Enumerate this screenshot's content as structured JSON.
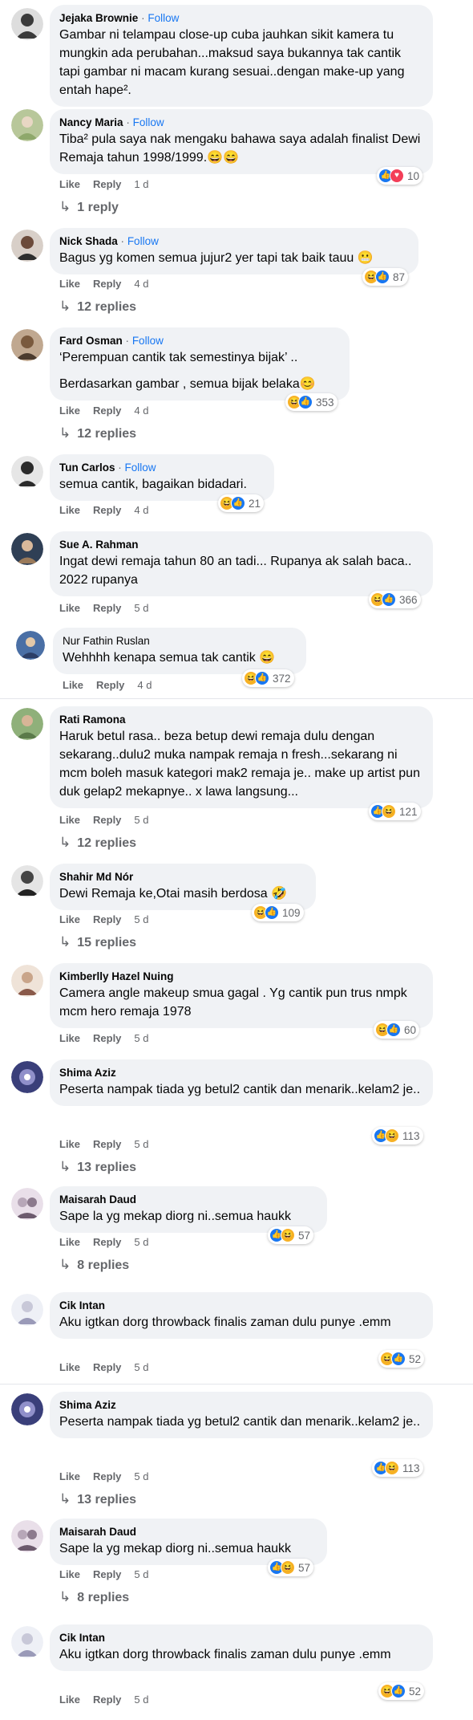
{
  "comments": [
    {
      "name": "Jejaka Brownie",
      "follow": "Follow",
      "lines": [
        "Gambar ni telampau close-up cuba jauhkan sikit kamera tu mungkin ada perubahan...maksud saya bukannya tak cantik tapi gambar ni macam kurang sesuai..dengan make-up yang entah hape²."
      ],
      "avatar_color": "#3a3a3a"
    },
    {
      "name": "Nancy Maria",
      "follow": "Follow",
      "lines": [
        "Tiba² pula saya nak mengaku bahawa saya adalah finalist Dewi Remaja tahun 1998/1999.😄😄"
      ],
      "like": "Like",
      "reply": "Reply",
      "time": "1 d",
      "reaction_count": "10",
      "reactions": [
        "like",
        "love"
      ],
      "replies": "1 reply",
      "avatar_color": "#b8c79a"
    },
    {
      "name": "Nick Shada",
      "follow": "Follow",
      "lines": [
        "Bagus yg komen semua jujur2 yer tapi tak baik tauu 😬"
      ],
      "like": "Like",
      "reply": "Reply",
      "time": "4 d",
      "reaction_count": "87",
      "reactions": [
        "haha",
        "like"
      ],
      "replies": "12 replies",
      "avatar_color": "#6b4a3a"
    },
    {
      "name": "Fard Osman",
      "follow": "Follow",
      "lines": [
        "‘Perempuan cantik tak semestinya bijak’ ..",
        "Berdasarkan gambar , semua bijak belaka😊"
      ],
      "like": "Like",
      "reply": "Reply",
      "time": "4 d",
      "reaction_count": "353",
      "reactions": [
        "haha",
        "like"
      ],
      "replies": "12 replies",
      "avatar_color": "#7a5a3e"
    },
    {
      "name": "Tun Carlos",
      "follow": "Follow",
      "lines": [
        "semua cantik, bagaikan bidadari."
      ],
      "like": "Like",
      "reply": "Reply",
      "time": "4 d",
      "reaction_count": "21",
      "reactions": [
        "haha",
        "like"
      ],
      "avatar_color": "#2b2b2b"
    },
    {
      "name": "Sue A. Rahman",
      "lines": [
        "Ingat dewi remaja tahun 80 an tadi... Rupanya ak salah baca.. 2022 rupanya"
      ],
      "like": "Like",
      "reply": "Reply",
      "time": "5 d",
      "reaction_count": "366",
      "reactions": [
        "haha",
        "like"
      ],
      "avatar_color": "#2f3f55"
    },
    {
      "name": "Nur Fathin Ruslan",
      "lines": [
        "Wehhhh kenapa semua tak cantik 😄"
      ],
      "like": "Like",
      "reply": "Reply",
      "time": "4 d",
      "reaction_count": "372",
      "reactions": [
        "haha",
        "like"
      ],
      "avatar_color": "#4a6fa5"
    },
    {
      "name": "Rati Ramona",
      "lines": [
        "Haruk betul rasa.. beza betup dewi remaja dulu dengan sekarang..dulu2 muka nampak remaja n fresh...sekarang ni mcm boleh masuk kategori mak2 remaja je.. make up artist pun duk gelap2 mekapnye.. x lawa langsung..."
      ],
      "like": "Like",
      "reply": "Reply",
      "time": "5 d",
      "reaction_count": "121",
      "reactions": [
        "like",
        "haha"
      ],
      "replies": "12 replies",
      "avatar_color": "#5a7a4a"
    },
    {
      "name": "Shahir Md Nór",
      "lines": [
        "Dewi Remaja ke,Otai masih berdosa 🤣"
      ],
      "like": "Like",
      "reply": "Reply",
      "time": "5 d",
      "reaction_count": "109",
      "reactions": [
        "haha",
        "like"
      ],
      "replies": "15 replies",
      "avatar_color": "#444444"
    },
    {
      "name": "Kimberlly Hazel Nuing",
      "lines": [
        "Camera angle makeup smua gagal . Yg cantik pun trus nmpk mcm hero remaja 1978"
      ],
      "like": "Like",
      "reply": "Reply",
      "time": "5 d",
      "reaction_count": "60",
      "reactions": [
        "haha",
        "like"
      ],
      "avatar_color": "#c9a58a"
    },
    {
      "name": "Shima Aziz",
      "lines": [
        "Peserta nampak tiada yg betul2 cantik dan menarik..kelam2 je.."
      ],
      "like": "Like",
      "reply": "Reply",
      "time": "5 d",
      "reaction_count": "113",
      "reactions": [
        "like",
        "haha"
      ],
      "replies": "13 replies",
      "avatar_color": "#3a3f7a"
    },
    {
      "name": "Maisarah Daud",
      "lines": [
        "Sape la yg mekap diorg ni..semua haukk"
      ],
      "like": "Like",
      "reply": "Reply",
      "time": "5 d",
      "reaction_count": "57",
      "reactions": [
        "like",
        "haha"
      ],
      "replies": "8 replies",
      "avatar_color": "#b7a7b8"
    },
    {
      "name": "Cik Intan",
      "lines": [
        "Aku igtkan dorg throwback finalis zaman dulu punye .emm"
      ],
      "like": "Like",
      "reply": "Reply",
      "time": "5 d",
      "reaction_count": "52",
      "reactions": [
        "haha",
        "like"
      ],
      "avatar_color": "#c8c8d8"
    },
    {
      "name": "Shima Aziz",
      "lines": [
        "Peserta nampak tiada yg betul2 cantik dan menarik..kelam2 je.."
      ],
      "like": "Like",
      "reply": "Reply",
      "time": "5 d",
      "reaction_count": "113",
      "reactions": [
        "like",
        "haha"
      ],
      "replies": "13 replies",
      "avatar_color": "#3a3f7a"
    },
    {
      "name": "Maisarah Daud",
      "lines": [
        "Sape la yg mekap diorg ni..semua haukk"
      ],
      "like": "Like",
      "reply": "Reply",
      "time": "5 d",
      "reaction_count": "57",
      "reactions": [
        "like",
        "haha"
      ],
      "replies": "8 replies",
      "avatar_color": "#b7a7b8"
    },
    {
      "name": "Cik Intan",
      "lines": [
        "Aku igtkan dorg throwback finalis zaman dulu punye .emm"
      ],
      "like": "Like",
      "reply": "Reply",
      "time": "5 d",
      "reaction_count": "52",
      "reactions": [
        "haha",
        "like"
      ],
      "avatar_color": "#c8c8d8"
    }
  ]
}
